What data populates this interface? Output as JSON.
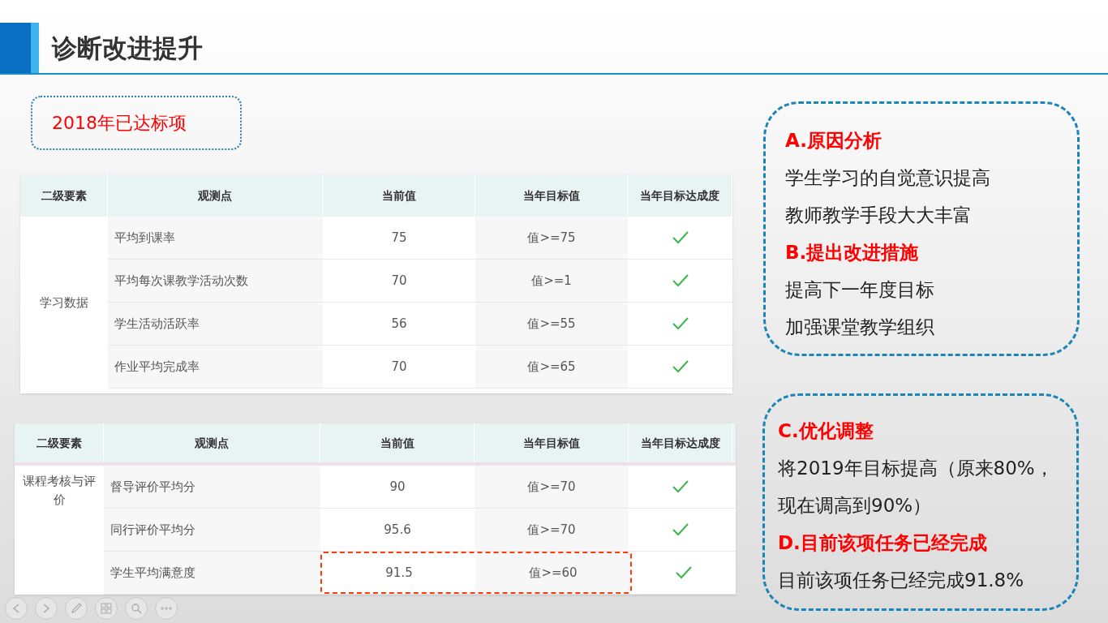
{
  "title": "诊断改进提升",
  "tag": "2018年已达标项",
  "tables": [
    {
      "columns": [
        "二级要素",
        "观测点",
        "当前值",
        "当年目标值",
        "当年目标达成度"
      ],
      "groups": [
        {
          "label": "学习数据",
          "rows": [
            {
              "observation": "平均到课率",
              "current": "75",
              "target": "值>=75",
              "achieved": true,
              "highlighted": false
            },
            {
              "observation": "平均每次课教学活动次数",
              "current": "70",
              "target": "值>=1",
              "achieved": true,
              "highlighted": false
            },
            {
              "observation": "学生活动活跃率",
              "current": "56",
              "target": "值>=55",
              "achieved": true,
              "highlighted": false
            },
            {
              "observation": "作业平均完成率",
              "current": "70",
              "target": "值>=65",
              "achieved": true,
              "highlighted": false
            }
          ]
        }
      ]
    },
    {
      "columns": [
        "二级要素",
        "观测点",
        "当前值",
        "当年目标值",
        "当年目标达成度"
      ],
      "groups": [
        {
          "label": "课程考核与评价",
          "rows": [
            {
              "observation": "督导评价平均分",
              "current": "90",
              "target": "值>=70",
              "achieved": true,
              "highlighted": false
            },
            {
              "observation": "同行评价平均分",
              "current": "95.6",
              "target": "值>=70",
              "achieved": true,
              "highlighted": false
            },
            {
              "observation": "学生平均满意度",
              "current": "91.5",
              "target": "值>=60",
              "achieved": true,
              "highlighted": true
            }
          ]
        }
      ]
    }
  ],
  "notes": [
    {
      "items": [
        {
          "kind": "heading",
          "text": "A.原因分析"
        },
        {
          "kind": "line",
          "text": "学生学习的自觉意识提高"
        },
        {
          "kind": "line",
          "text": "教师教学手段大大丰富"
        },
        {
          "kind": "heading",
          "text": "B.提出改进措施"
        },
        {
          "kind": "line",
          "text": "提高下一年度目标"
        },
        {
          "kind": "line",
          "text": "加强课堂教学组织"
        }
      ]
    },
    {
      "items": [
        {
          "kind": "heading",
          "text": "C.优化调整"
        },
        {
          "kind": "line",
          "text": "将2019年目标提高（原来80%，"
        },
        {
          "kind": "line",
          "text": "现在调高到90%）"
        },
        {
          "kind": "heading",
          "text": "D.目前该项任务已经完成"
        },
        {
          "kind": "line",
          "text": "目前该项任务已经完成91.8%"
        }
      ]
    }
  ]
}
